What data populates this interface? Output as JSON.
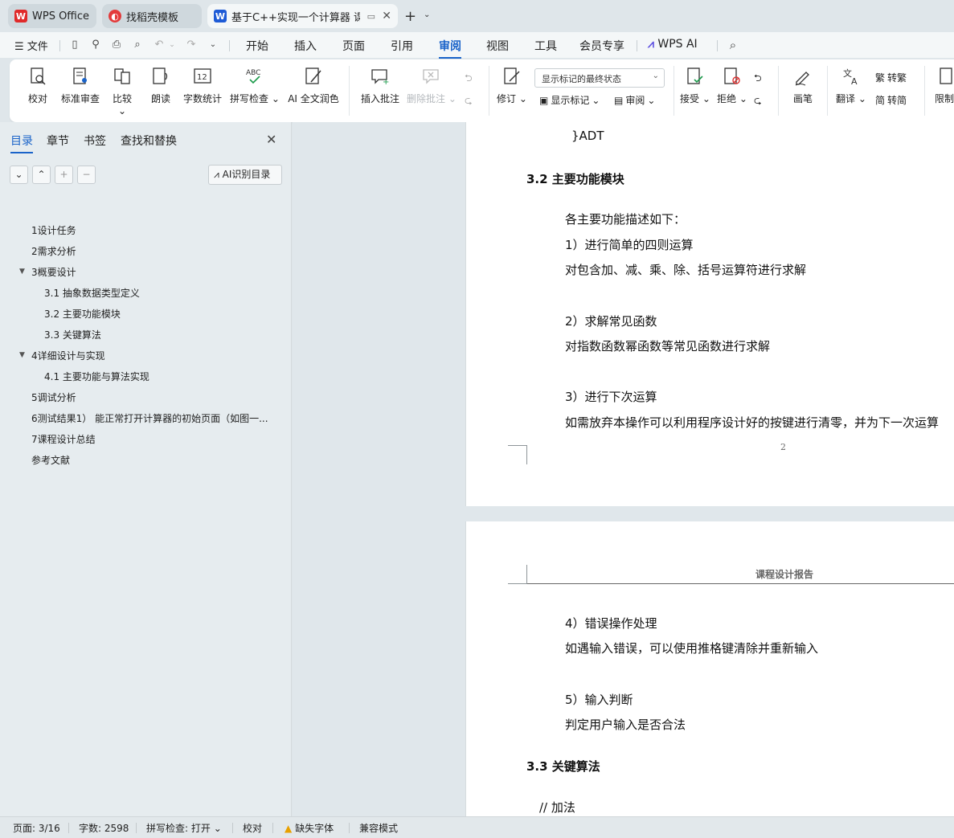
{
  "tabs": [
    {
      "label": "WPS Office",
      "icon": "wps-logo-icon",
      "color": "#e02a2a"
    },
    {
      "label": "找稻壳模板",
      "icon": "docer-logo-icon",
      "color": "#e33b3b"
    },
    {
      "label": "基于C++实现一个计算器 课",
      "icon": "word-doc-icon",
      "color": "#1e5bd6"
    }
  ],
  "menu": {
    "file": "文件",
    "items": [
      "开始",
      "插入",
      "页面",
      "引用",
      "审阅",
      "视图",
      "工具",
      "会员专享"
    ],
    "active": "审阅",
    "wps_ai": "WPS AI"
  },
  "ribbon": {
    "proofread": "校对",
    "standard_review": "标准审查",
    "compare": "比较",
    "read_aloud": "朗读",
    "word_count": "字数统计",
    "spell_check": "拼写检查",
    "ai_polish": "AI 全文润色",
    "insert_comment": "插入批注",
    "delete_comment": "删除批注",
    "track_changes": "修订",
    "markup_combo": "显示标记的最终状态",
    "show_markup": "显示标记",
    "review": "审阅",
    "accept": "接受",
    "reject": "拒绝",
    "pen": "画笔",
    "translate": "翻译",
    "to_traditional": "转繁",
    "to_simplified": "转简",
    "restrict": "限制"
  },
  "left_panel": {
    "tabs": [
      "目录",
      "章节",
      "书签",
      "查找和替换"
    ],
    "ai_toc": "AI识别目录",
    "toc": [
      {
        "label": "1设计任务",
        "level": 1
      },
      {
        "label": "2需求分析",
        "level": 1
      },
      {
        "label": "3概要设计",
        "level": 1,
        "expanded": true
      },
      {
        "label": "3.1 抽象数据类型定义",
        "level": 2
      },
      {
        "label": "3.2  主要功能模块",
        "level": 2
      },
      {
        "label": "3.3  关键算法",
        "level": 2
      },
      {
        "label": "4详细设计与实现",
        "level": 1,
        "expanded": true
      },
      {
        "label": "4.1  主要功能与算法实现",
        "level": 2
      },
      {
        "label": "5调试分析",
        "level": 1
      },
      {
        "label": "6测试结果1） 能正常打开计算器的初始页面（如图一...",
        "level": 1
      },
      {
        "label": "7课程设计总结",
        "level": 1
      },
      {
        "label": "参考文献",
        "level": 1
      }
    ]
  },
  "document": {
    "adt_close": "}ADT",
    "h32": "3.2  主要功能模块",
    "intro": "各主要功能描述如下：",
    "f1_title": "1）进行简单的四则运算",
    "f1_desc": "对包含加、减、乘、除、括号运算符进行求解",
    "f2_title": "2）求解常见函数",
    "f2_desc": "对指数函数幂函数等常见函数进行求解",
    "f3_title": "3）进行下次运算",
    "f3_desc": "如需放弃本操作可以利用程序设计好的按键进行清零，并为下一次运算",
    "page_number": "2",
    "header": "课程设计报告",
    "f4_title": "4）错误操作处理",
    "f4_desc": "如遇输入错误，可以使用推格键清除并重新输入",
    "f5_title": "5）输入判断",
    "f5_desc": "判定用户输入是否合法",
    "h33": "3.3  关键算法",
    "comment_add": "// 加法"
  },
  "status": {
    "page": "页面: 3/16",
    "words": "字数: 2598",
    "spell": "拼写检查: 打开",
    "proof": "校对",
    "missing_font": "缺失字体",
    "compat": "兼容模式"
  },
  "colors": {
    "accent": "#1a63c9",
    "warning": "#e8a000"
  }
}
